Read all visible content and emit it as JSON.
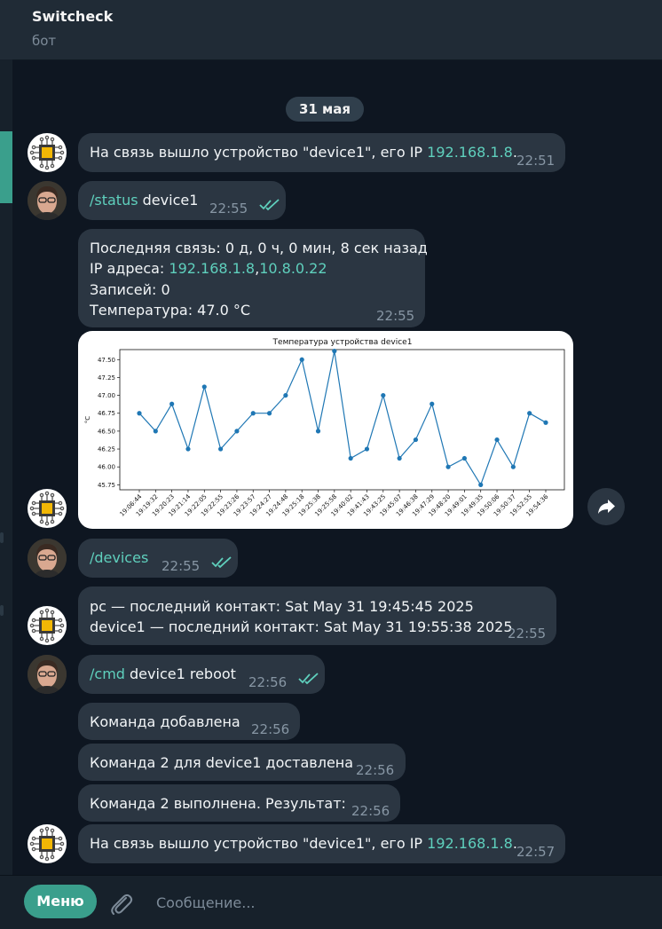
{
  "header": {
    "title": "Switcheck",
    "subtitle": "бот"
  },
  "date_separator": "31 мая",
  "messages": [
    {
      "text": "На связь вышло устройство \"device1\", его IP ",
      "ip": "192.168.1.8",
      "tail": ".",
      "time": "22:51"
    },
    {
      "command": "/status",
      "arg": " device1",
      "time": "22:55"
    },
    {
      "line1": "Последняя связь: 0 д, 0 ч, 0 мин, 8 сек назад",
      "ip_label": "IP адреса: ",
      "ip1": "192.168.1.8",
      "ip_sep": ",",
      "ip2": "10.8.0.22",
      "line3": "Записей: 0",
      "line4": "Температура: 47.0 °C",
      "time": "22:55"
    },
    {
      "command": "/devices",
      "time": "22:55"
    },
    {
      "line1": "pc — последний контакт: Sat May 31 19:45:45 2025",
      "line2": "device1 — последний контакт: Sat May 31 19:55:38 2025",
      "time": "22:55"
    },
    {
      "command": "/cmd",
      "arg": " device1 reboot",
      "time": "22:56"
    },
    {
      "text": "Команда добавлена",
      "time": "22:56"
    },
    {
      "text": "Команда 2 для device1 доставлена",
      "time": "22:56"
    },
    {
      "text": "Команда 2 выполнена. Результат:",
      "time": "22:56"
    },
    {
      "text": "На связь вышло устройство \"device1\", его IP ",
      "ip": "192.168.1.8",
      "tail": ".",
      "time": "22:57"
    }
  ],
  "chart_data": {
    "type": "line",
    "title": "Температура устройства device1",
    "xlabel": "",
    "ylabel": "°C",
    "ylim": [
      45.68,
      47.64
    ],
    "yticks": [
      "45.75",
      "46.00",
      "46.25",
      "46.50",
      "46.75",
      "47.00",
      "47.25",
      "47.50"
    ],
    "x": [
      "19:06:44",
      "19:19:32",
      "19:20:23",
      "19:21:14",
      "19:22:05",
      "19:22:55",
      "19:23:26",
      "19:23:57",
      "19:24:27",
      "19:24:48",
      "19:25:18",
      "19:25:38",
      "19:25:58",
      "19:40:02",
      "19:41:43",
      "19:43:25",
      "19:45:07",
      "19:46:38",
      "19:47:29",
      "19:48:20",
      "19:49:01",
      "19:49:35",
      "19:50:06",
      "19:50:37",
      "19:52:55",
      "19:54:36"
    ],
    "values": [
      46.75,
      46.5,
      46.88,
      46.25,
      47.12,
      46.25,
      46.5,
      46.75,
      46.75,
      47.0,
      47.5,
      46.5,
      47.62,
      46.12,
      46.25,
      47.0,
      46.12,
      46.38,
      46.88,
      46.0,
      46.12,
      45.75,
      46.38,
      46.0,
      46.75,
      46.62
    ],
    "color": "#1f77b4",
    "grid": false
  },
  "composer": {
    "menu_label": "Меню",
    "placeholder": "Сообщение..."
  },
  "colors": {
    "accent": "#3a9f8c",
    "link": "#5fd0bd",
    "bubble": "#2b3642",
    "background": "#0e1621"
  }
}
